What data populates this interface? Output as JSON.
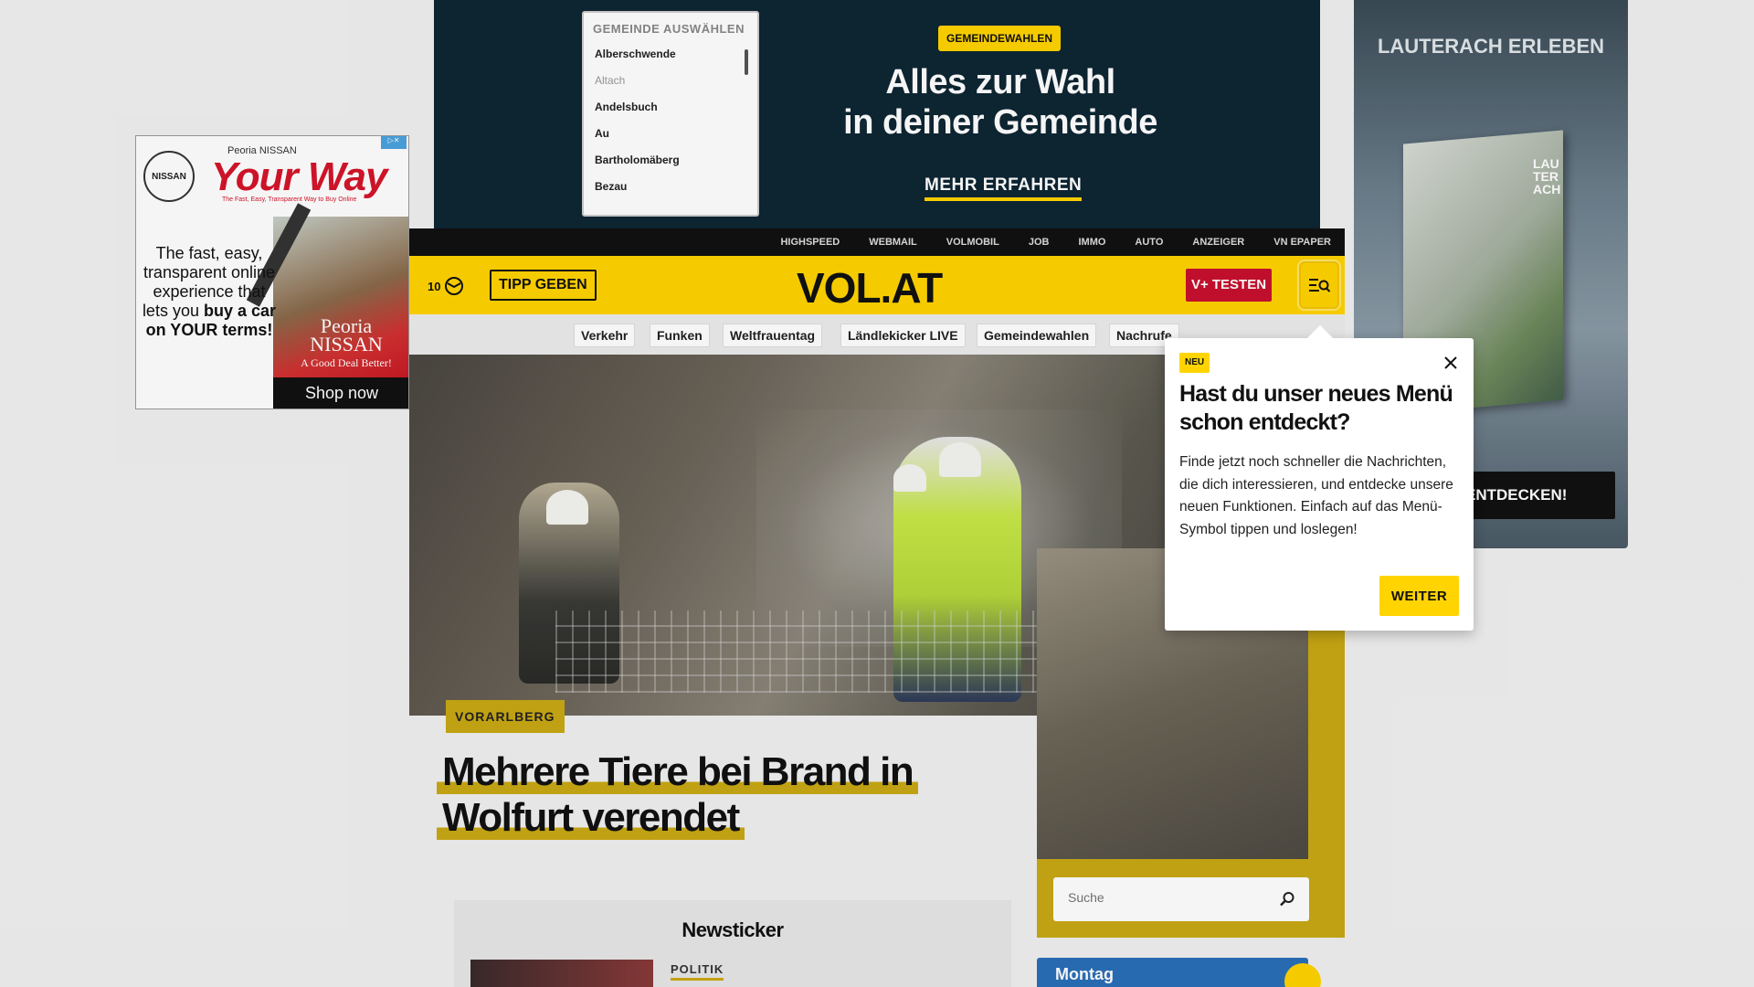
{
  "ad_left": {
    "brand": "NISSAN",
    "dealer_small": "Peoria NISSAN",
    "headline": "Your Way",
    "tagline": "The Fast, Easy, Transparent Way to Buy Online",
    "body": "The fast, easy, transparent online experience that lets you",
    "body_bold": "buy a car on YOUR terms!",
    "dealer": "Peoria",
    "dealer_brand": "NISSAN",
    "dealer_slogan": "A Good Deal Better!",
    "cta": "Shop now"
  },
  "top_banner": {
    "list_header": "GEMEINDE AUSWÄHLEN",
    "municipalities": [
      "Alberschwende",
      "Altach",
      "Andelsbuch",
      "Au",
      "Bartholomäberg",
      "Bezau"
    ],
    "badge": "GEMEINDEWAHLEN",
    "title_line1": "Alles zur Wahl",
    "title_line2": "in deiner Gemeinde",
    "cta": "MEHR ERFAHREN"
  },
  "ad_right": {
    "title": "LAUTERACH ERLEBEN",
    "book_text": "LAU TER ACH",
    "cta": "ENTDECKEN!"
  },
  "util_links": [
    "HIGHSPEED",
    "WEBMAIL",
    "VOLMOBIL",
    "JOB",
    "IMMO",
    "AUTO",
    "ANZEIGER",
    "VN EPAPER"
  ],
  "header": {
    "count": "10",
    "tipp_label": "TIPP GEBEN",
    "logo": "VOL.AT",
    "vplus_label": "V+ TESTEN"
  },
  "categories": [
    "Verkehr",
    "Funken",
    "Weltfrauentag",
    "Ländlekicker LIVE",
    "Gemeindewahlen",
    "Nachrufe"
  ],
  "article": {
    "tag": "VORARLBERG",
    "headline": "Mehrere Tiere bei Brand in Wolfurt verendet"
  },
  "search": {
    "placeholder": "Suche"
  },
  "newsticker": {
    "title": "Newsticker",
    "category": "POLITIK"
  },
  "weather": {
    "day": "Montag"
  },
  "popup": {
    "badge": "NEU",
    "title": "Hast du unser neues Menü schon entdeckt?",
    "body": "Finde jetzt noch schneller die Nachrichten, die dich interessieren, und entdecke unsere neuen Funktionen. Einfach auf das Menü-Symbol tippen und loslegen!",
    "button": "WEITER"
  },
  "colors": {
    "accent": "#ffd400",
    "accent_dark": "#c8a814",
    "vplus": "#c8102e",
    "banner_bg": "#0e2633"
  }
}
